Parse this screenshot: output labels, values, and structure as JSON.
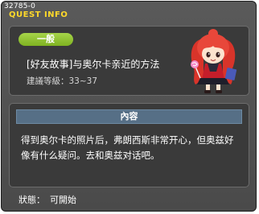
{
  "window": {
    "id_tag": "32785-0",
    "title": "QUEST INFO"
  },
  "quest": {
    "type_label": "一般",
    "name": "[好友故事]与奥尔卡亲近的方法",
    "level_label": "建議等級：",
    "level_range": "33~37"
  },
  "content": {
    "header": "內容",
    "text": "得到奥尔卡的照片后，弗朗西斯非常开心，但奥兹好像有什么疑问。去和奥兹对话吧。"
  },
  "status": {
    "label": "狀態：",
    "value": "可開始"
  },
  "colors": {
    "title": "#ffd92a",
    "type_pill": "#8cc032",
    "content_header": "#566f86"
  },
  "icons": {
    "portrait": "quest-npc-portrait"
  }
}
